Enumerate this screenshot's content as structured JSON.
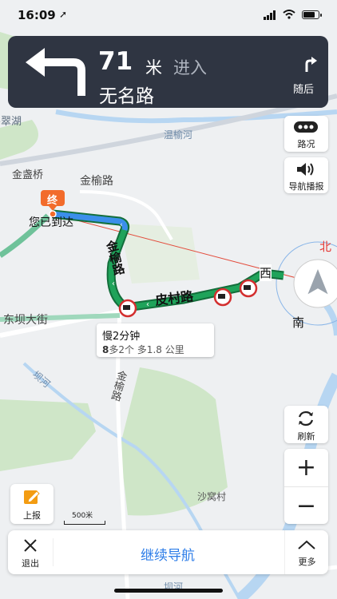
{
  "status_bar": {
    "time": "16:09",
    "location_arrow": "➚"
  },
  "navigation": {
    "distance": "71",
    "unit": "米",
    "action": "进入",
    "road": "无名路",
    "next_label": "随后"
  },
  "map": {
    "places": {
      "lake": "碧翠湖",
      "river1": "温榆河",
      "bridge": "金盏桥",
      "road_jinyu_top": "金榆路",
      "road_jinyu_vertical": "金榆路",
      "road_pi_cun": "皮村路",
      "road_dongba": "东坝大街",
      "river2": "坝河",
      "road_jinyu_bottom": "金榆路",
      "village": "沙窝村",
      "river3": "坝河"
    },
    "destination": {
      "badge": "终",
      "label": "您已到达"
    },
    "compass": {
      "north": "北",
      "west": "西",
      "south": "南"
    },
    "route_tip": {
      "line1": "慢2分钟",
      "line2": "多2个  多1.8 公里",
      "line2_icon": "8"
    },
    "scale_label": "500米"
  },
  "controls": {
    "traffic": "路况",
    "voice": "导航播报",
    "refresh": "刷新",
    "zoom_in": "+",
    "zoom_out": "−",
    "report": "上报"
  },
  "bottom_bar": {
    "exit": "退出",
    "continue": "继续导航",
    "more": "更多"
  },
  "colors": {
    "nav_card": "#2f3542",
    "route_green": "#1fa35a",
    "route_blue": "#3b8eea",
    "accent_blue": "#2d7de8",
    "destination_orange": "#f26b2b",
    "north_red": "#e53935"
  }
}
